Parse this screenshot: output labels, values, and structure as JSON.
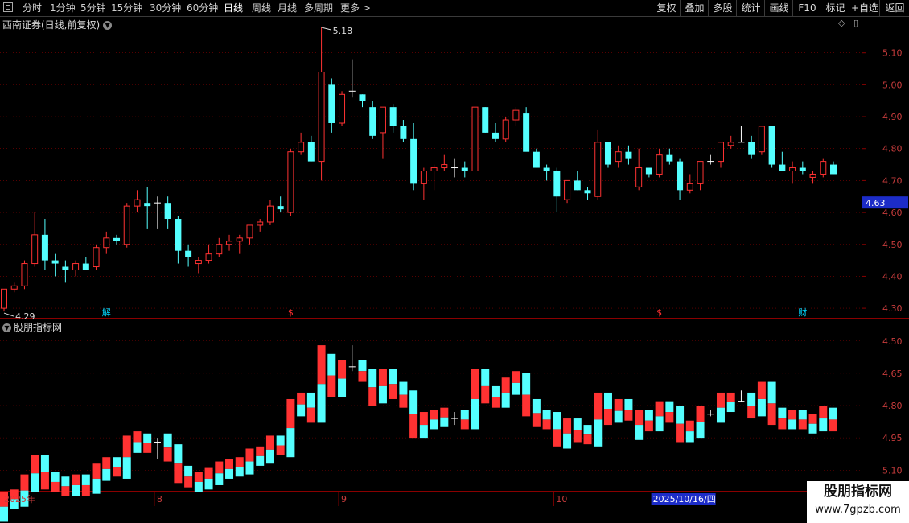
{
  "toolbar": {
    "left": [
      "分时",
      "1分钟",
      "5分钟",
      "15分钟",
      "30分钟",
      "60分钟",
      "日线",
      "周线",
      "月线",
      "多周期",
      "更多 >"
    ],
    "active": "日线",
    "right": [
      "复权",
      "叠加",
      "多股",
      "统计",
      "画线",
      "F10",
      "标记",
      "+自选",
      "返回"
    ]
  },
  "chart_title": "西南证券(日线,前复权)",
  "indicator_title": "股朋指标网",
  "price_axis": [
    "5.10",
    "5.00",
    "4.90",
    "4.80",
    "4.70",
    "4.60",
    "4.50",
    "4.40",
    "4.30"
  ],
  "current_price": "4.63",
  "indicator_axis": [
    "5.10",
    "4.95",
    "4.80",
    "4.65",
    "4.50"
  ],
  "max_label": "5.18",
  "min_label": "4.29",
  "event_markers": [
    {
      "label": "解",
      "color": "#00d8ff",
      "index": 10
    },
    {
      "label": "$",
      "color": "#ff3030",
      "index": 28
    },
    {
      "label": "$",
      "color": "#ff3030",
      "index": 64
    },
    {
      "label": "财",
      "color": "#00d8ff",
      "index": 78
    }
  ],
  "date_axis": {
    "year": "2025年",
    "months": [
      "8",
      "9",
      "10"
    ],
    "selected_date": "2025/10/16/四",
    "last": "1"
  },
  "watermark": {
    "title": "股朋指标网",
    "url": "www.7gpzb.com"
  },
  "colors": {
    "up": "#ff3232",
    "down": "#54ffff",
    "flat": "#ffffff",
    "grid": "#8a0000",
    "axis_text": "#c83c3c"
  },
  "chart_data": {
    "type": "candlestick",
    "ylim": [
      4.27,
      5.19
    ],
    "yticks": [
      4.3,
      4.4,
      4.5,
      4.6,
      4.7,
      4.8,
      4.9,
      5.0,
      5.1
    ],
    "candles": [
      [
        4.3,
        4.36,
        4.29,
        4.36
      ],
      [
        4.36,
        4.38,
        4.35,
        4.37
      ],
      [
        4.37,
        4.45,
        4.36,
        4.44
      ],
      [
        4.44,
        4.6,
        4.43,
        4.53
      ],
      [
        4.53,
        4.58,
        4.42,
        4.45
      ],
      [
        4.45,
        4.47,
        4.4,
        4.44
      ],
      [
        4.43,
        4.45,
        4.38,
        4.42
      ],
      [
        4.42,
        4.45,
        4.4,
        4.44
      ],
      [
        4.44,
        4.46,
        4.42,
        4.42
      ],
      [
        4.43,
        4.5,
        4.42,
        4.49
      ],
      [
        4.49,
        4.54,
        4.47,
        4.52
      ],
      [
        4.52,
        4.53,
        4.5,
        4.51
      ],
      [
        4.5,
        4.63,
        4.49,
        4.62
      ],
      [
        4.62,
        4.67,
        4.6,
        4.64
      ],
      [
        4.63,
        4.68,
        4.55,
        4.62
      ],
      [
        4.63,
        4.65,
        4.55,
        4.63
      ],
      [
        4.63,
        4.65,
        4.55,
        4.58
      ],
      [
        4.58,
        4.59,
        4.44,
        4.48
      ],
      [
        4.48,
        4.5,
        4.43,
        4.46
      ],
      [
        4.44,
        4.46,
        4.41,
        4.45
      ],
      [
        4.45,
        4.5,
        4.44,
        4.47
      ],
      [
        4.47,
        4.52,
        4.46,
        4.5
      ],
      [
        4.5,
        4.53,
        4.48,
        4.51
      ],
      [
        4.51,
        4.53,
        4.47,
        4.52
      ],
      [
        4.52,
        4.56,
        4.5,
        4.56
      ],
      [
        4.56,
        4.58,
        4.54,
        4.57
      ],
      [
        4.57,
        4.64,
        4.56,
        4.62
      ],
      [
        4.62,
        4.65,
        4.6,
        4.61
      ],
      [
        4.6,
        4.8,
        4.59,
        4.79
      ],
      [
        4.79,
        4.85,
        4.78,
        4.82
      ],
      [
        4.82,
        4.84,
        4.76,
        4.76
      ],
      [
        4.76,
        5.18,
        4.7,
        5.04
      ],
      [
        5.0,
        5.02,
        4.85,
        4.88
      ],
      [
        4.88,
        4.98,
        4.87,
        4.97
      ],
      [
        4.98,
        5.08,
        4.96,
        4.98
      ],
      [
        4.97,
        4.97,
        4.93,
        4.95
      ],
      [
        4.93,
        4.95,
        4.83,
        4.84
      ],
      [
        4.85,
        4.93,
        4.77,
        4.93
      ],
      [
        4.93,
        4.94,
        4.85,
        4.87
      ],
      [
        4.87,
        4.89,
        4.82,
        4.83
      ],
      [
        4.83,
        4.88,
        4.67,
        4.69
      ],
      [
        4.69,
        4.74,
        4.64,
        4.73
      ],
      [
        4.73,
        4.75,
        4.67,
        4.74
      ],
      [
        4.74,
        4.78,
        4.73,
        4.75
      ],
      [
        4.74,
        4.77,
        4.71,
        4.74
      ],
      [
        4.74,
        4.76,
        4.71,
        4.73
      ],
      [
        4.73,
        4.93,
        4.71,
        4.93
      ],
      [
        4.93,
        4.93,
        4.85,
        4.85
      ],
      [
        4.85,
        4.88,
        4.82,
        4.83
      ],
      [
        4.83,
        4.9,
        4.82,
        4.89
      ],
      [
        4.89,
        4.93,
        4.87,
        4.92
      ],
      [
        4.91,
        4.93,
        4.8,
        4.79
      ],
      [
        4.79,
        4.8,
        4.74,
        4.74
      ],
      [
        4.74,
        4.75,
        4.7,
        4.73
      ],
      [
        4.73,
        4.74,
        4.6,
        4.65
      ],
      [
        4.64,
        4.7,
        4.63,
        4.7
      ],
      [
        4.7,
        4.73,
        4.67,
        4.67
      ],
      [
        4.67,
        4.68,
        4.64,
        4.66
      ],
      [
        4.65,
        4.86,
        4.64,
        4.82
      ],
      [
        4.82,
        4.82,
        4.74,
        4.75
      ],
      [
        4.76,
        4.81,
        4.74,
        4.79
      ],
      [
        4.79,
        4.81,
        4.75,
        4.77
      ],
      [
        4.68,
        4.8,
        4.67,
        4.74
      ],
      [
        4.74,
        4.74,
        4.71,
        4.72
      ],
      [
        4.72,
        4.8,
        4.71,
        4.78
      ],
      [
        4.78,
        4.8,
        4.75,
        4.76
      ],
      [
        4.76,
        4.77,
        4.64,
        4.67
      ],
      [
        4.67,
        4.72,
        4.66,
        4.69
      ],
      [
        4.69,
        4.76,
        4.67,
        4.76
      ],
      [
        4.76,
        4.78,
        4.75,
        4.76
      ],
      [
        4.76,
        4.82,
        4.74,
        4.82
      ],
      [
        4.81,
        4.84,
        4.8,
        4.82
      ],
      [
        4.82,
        4.87,
        4.82,
        4.82
      ],
      [
        4.82,
        4.84,
        4.77,
        4.78
      ],
      [
        4.79,
        4.87,
        4.78,
        4.87
      ],
      [
        4.87,
        4.87,
        4.74,
        4.75
      ],
      [
        4.75,
        4.79,
        4.73,
        4.73
      ],
      [
        4.73,
        4.76,
        4.69,
        4.74
      ],
      [
        4.74,
        4.76,
        4.72,
        4.73
      ],
      [
        4.71,
        4.73,
        4.69,
        4.72
      ],
      [
        4.72,
        4.77,
        4.71,
        4.76
      ],
      [
        4.75,
        4.76,
        4.72,
        4.72
      ]
    ],
    "indicator_ylim": [
      4.4,
      5.2
    ],
    "indicator_yticks": [
      4.5,
      4.65,
      4.8,
      4.95,
      5.1
    ]
  }
}
